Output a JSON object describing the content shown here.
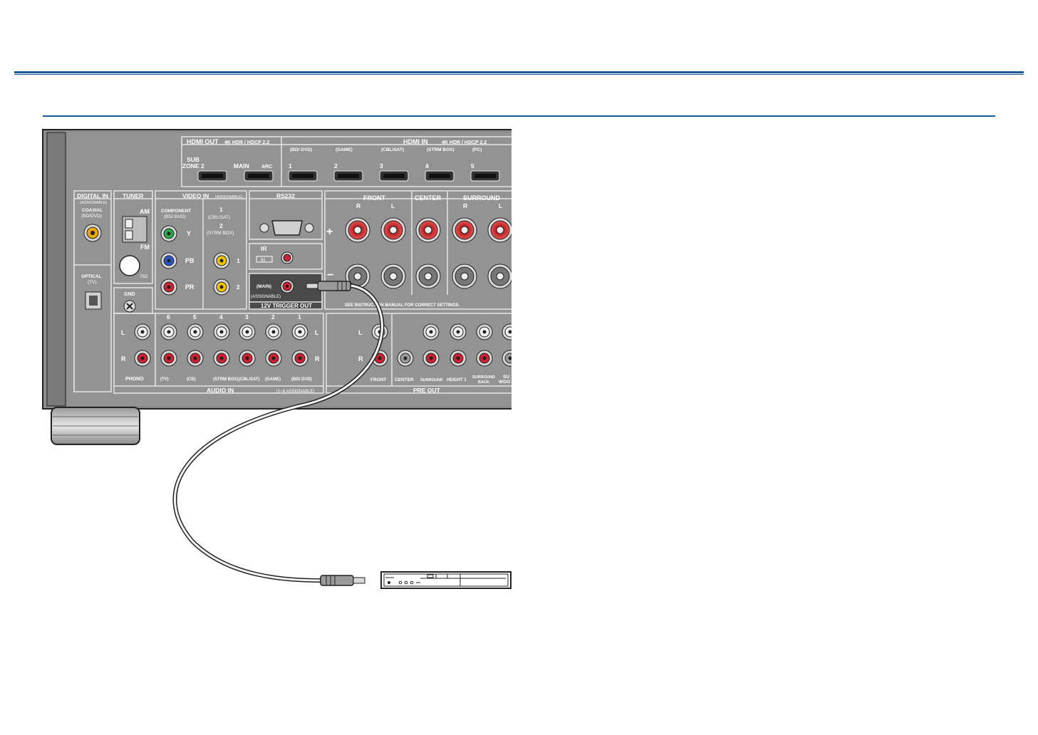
{
  "hdmi_out": {
    "title": "HDMI OUT",
    "spec": "4K HDR / HDCP 2.2",
    "sub": "SUB",
    "zone2": "ZONE 2",
    "main": "MAIN",
    "arc": "ARC"
  },
  "hdmi_in": {
    "title": "HDMI IN",
    "spec": "4K HDR / HDCP 2.2",
    "ports": [
      {
        "num": "1",
        "name": "(BD/ DVD)"
      },
      {
        "num": "2",
        "name": "(GAME)"
      },
      {
        "num": "3",
        "name": "(CBL/SAT)"
      },
      {
        "num": "4",
        "name": "(STRM BOX)"
      },
      {
        "num": "5",
        "name": "(PC)"
      }
    ]
  },
  "digital_in": {
    "title": "DIGITAL IN",
    "assignable": "(ASSIGNABLE)",
    "coaxial": "COAXIAL",
    "coaxial_src": "(BD/DVD)",
    "optical": "OPTICAL",
    "optical_src": "(TV)"
  },
  "tuner": {
    "title": "TUNER",
    "am": "AM",
    "fm": "FM",
    "ohm": "75Ω"
  },
  "video_in": {
    "title": "VIDEO IN",
    "assignable": "(ASSIGNABLE)",
    "component": "COMPONENT",
    "component_src": "(BD/ DVD)",
    "y": "Y",
    "pb": "PB",
    "pr": "PR",
    "in1": "1",
    "in1_src": "(CBL/SAT)",
    "in2": "2",
    "in2_src": "(STRM BOX)",
    "jack1": "1",
    "jack2": "2"
  },
  "rs232": {
    "title": "RS232"
  },
  "ir": {
    "title": "IR",
    "in": "IN"
  },
  "trigger": {
    "main": "(MAIN)",
    "assignable": "(ASSIGNABLE)",
    "title": "12V TRIGGER OUT"
  },
  "speakers": {
    "front": "FRONT",
    "center": "CENTER",
    "surround": "SURROUND",
    "r": "R",
    "l": "L",
    "plus": "+",
    "minus": "−",
    "note": "SEE INSTRUCTION MANUAL FOR CORRECT SETTINGS."
  },
  "gnd": {
    "label": "GND"
  },
  "audio_in": {
    "title": "AUDIO IN",
    "range": "(1~6 ASSIGNABLE)",
    "phono": "PHONO",
    "l": "L",
    "r": "R",
    "numbers": [
      "6",
      "5",
      "4",
      "3",
      "2",
      "1"
    ],
    "sources": [
      "(TV)",
      "(CD)",
      "(STRM BOX)",
      "(CBL/SAT)",
      "(GAME)",
      "(BD/ DVD)"
    ]
  },
  "pre_out": {
    "title": "PRE OUT",
    "l": "L",
    "r": "R",
    "front": "FRONT",
    "center": "CENTER",
    "surround": "SURROUND",
    "height1": "HEIGHT 1",
    "surround_back_1": "SURROUND",
    "surround_back_2": "BACK",
    "sub_1": "SU",
    "sub_2": "WOO"
  },
  "colors": {
    "accent": "#1a5a9c",
    "panel": "#8c8c8c",
    "panel_dark": "#6e6e6e",
    "red": "#cc2233",
    "yellow": "#f2c200",
    "green": "#2aa84a",
    "blue": "#2a56c8"
  }
}
